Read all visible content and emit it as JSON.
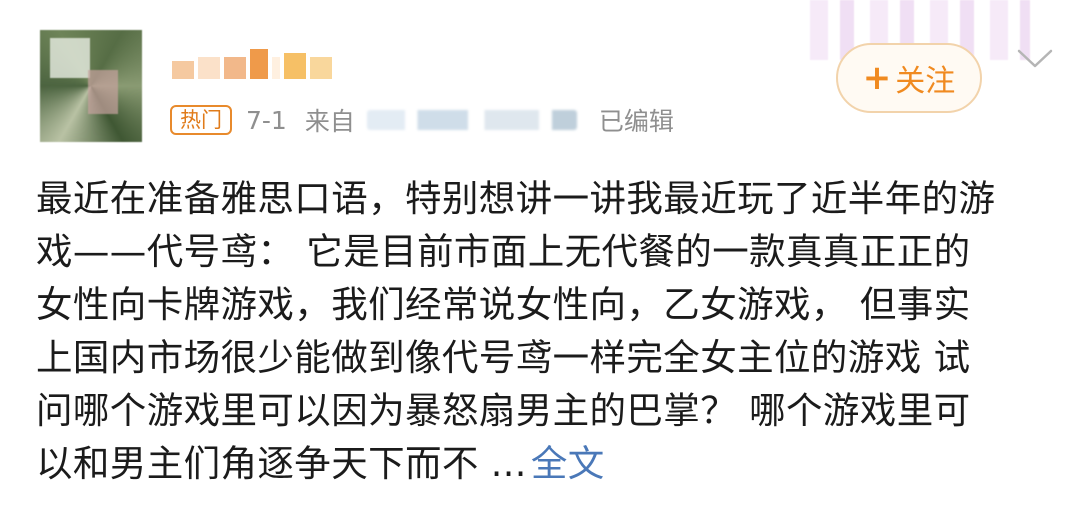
{
  "author": {
    "avatar_icon": "user-avatar-icon"
  },
  "meta": {
    "hot_badge": "热门",
    "date": "7-1",
    "from_label": "来自",
    "edited_label": "已编辑"
  },
  "follow_button": {
    "plus": "+",
    "label": "关注"
  },
  "menu_icon": "chevron-down-icon",
  "post": {
    "lines": [
      "最近在准备雅思口语，特别想讲一讲我最近玩了近半年的游",
      "戏——代号鸢：  它是目前市面上无代餐的一款真真正正的",
      "女性向卡牌游戏，我们经常说女性向，乙女游戏，  但事实",
      "上国内市场很少能做到像代号鸢一样完全女主位的游戏 试",
      "问哪个游戏里可以因为暴怒扇男主的巴掌？  哪个游戏里可",
      "以和男主们角逐争天下而不 ..."
    ],
    "full_text_link": "全文"
  },
  "colors": {
    "accent_orange": "#f08a20",
    "link_blue": "#4a78b8",
    "meta_gray": "#8f8f8f"
  }
}
